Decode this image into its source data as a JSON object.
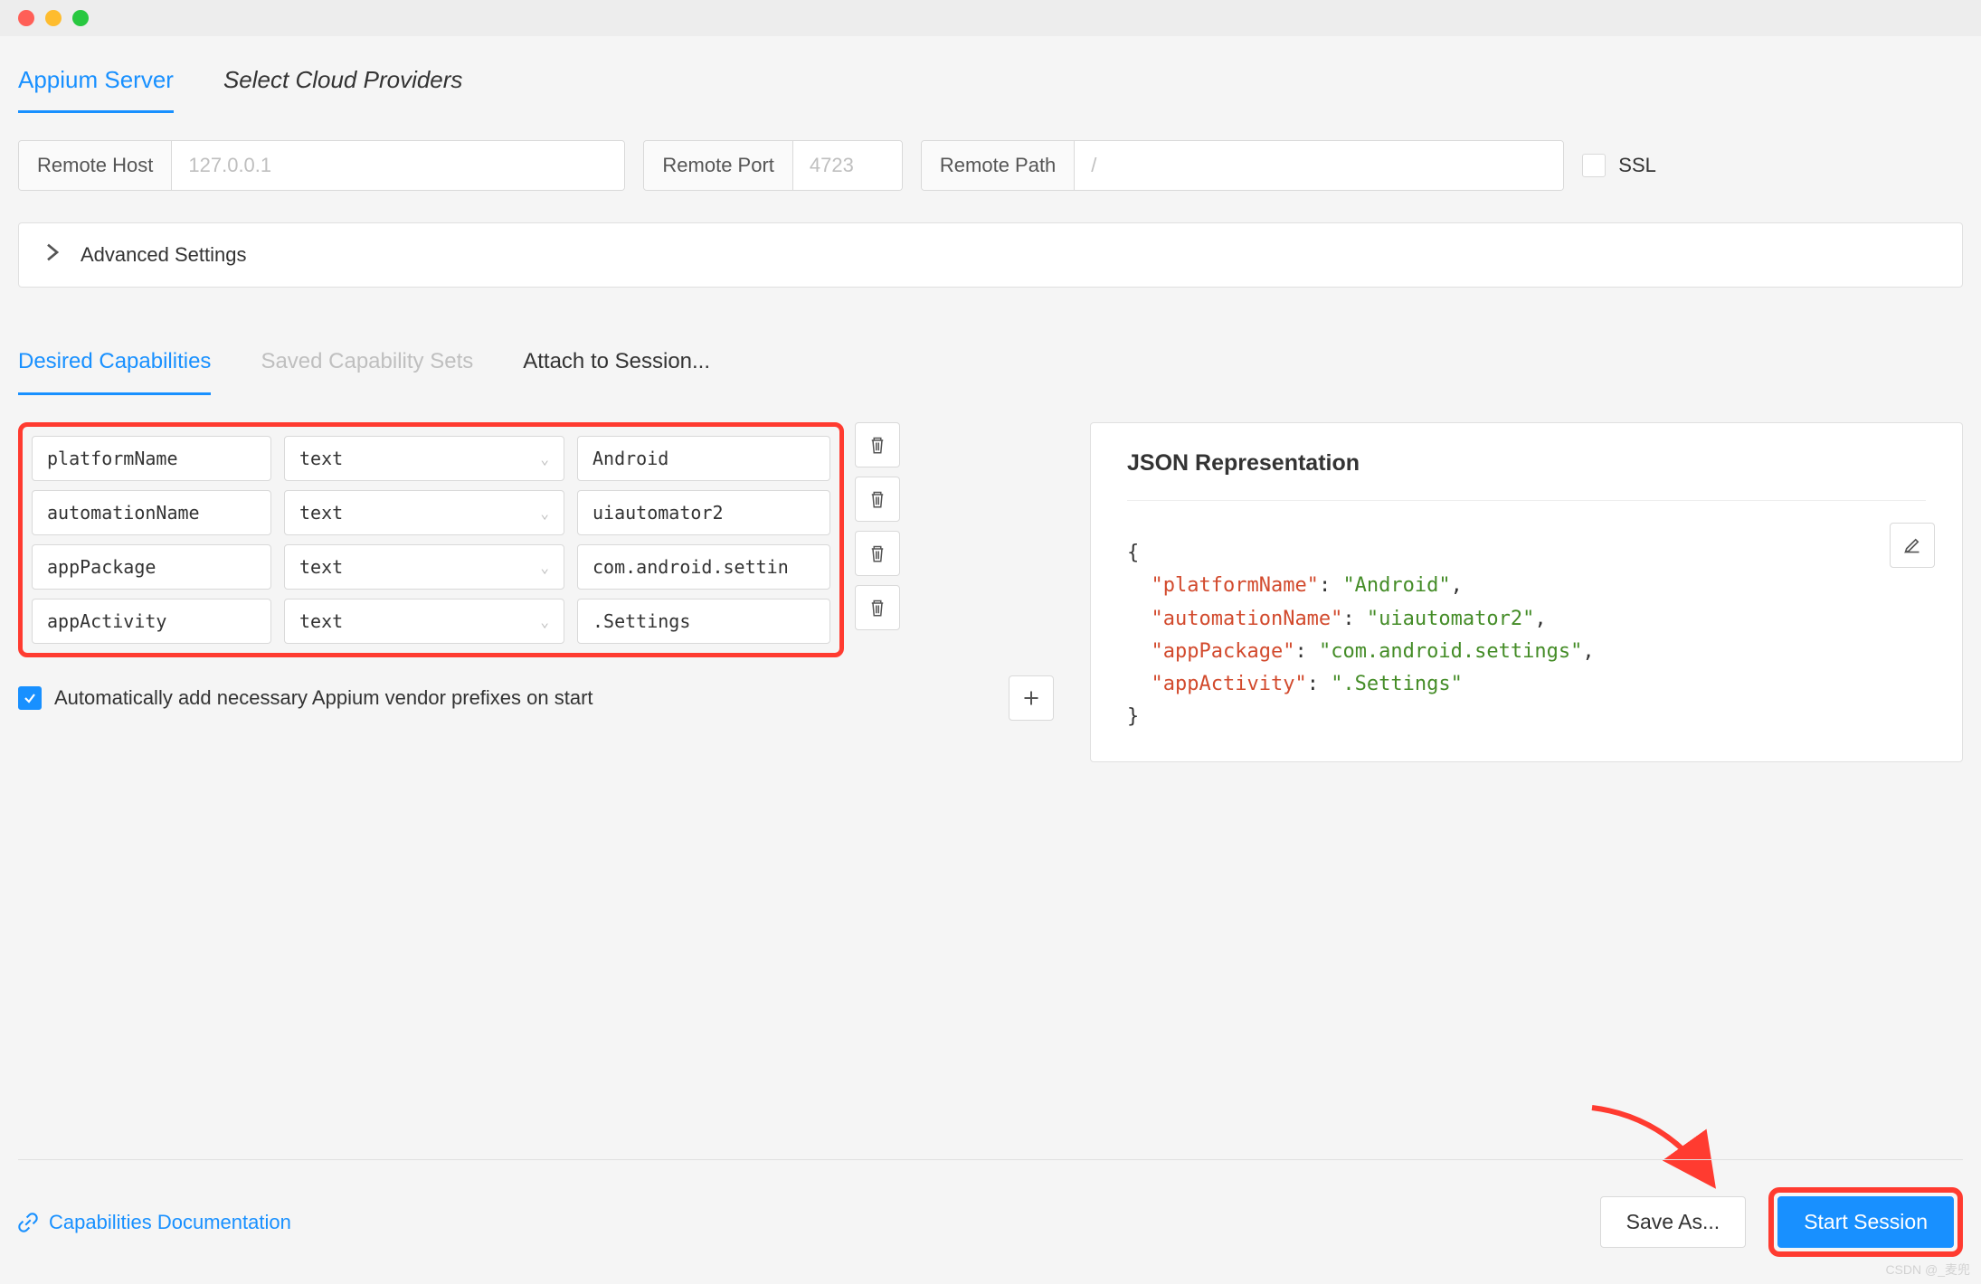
{
  "tabs": {
    "server": "Appium Server",
    "cloud": "Select Cloud Providers"
  },
  "conn": {
    "remoteHostLabel": "Remote Host",
    "remoteHostPlaceholder": "127.0.0.1",
    "remotePortLabel": "Remote Port",
    "remotePortPlaceholder": "4723",
    "remotePathLabel": "Remote Path",
    "remotePathPlaceholder": "/",
    "sslLabel": "SSL"
  },
  "advanced": {
    "label": "Advanced Settings"
  },
  "capTabs": {
    "desired": "Desired Capabilities",
    "saved": "Saved Capability Sets",
    "attach": "Attach to Session..."
  },
  "caps": [
    {
      "name": "platformName",
      "type": "text",
      "value": "Android"
    },
    {
      "name": "automationName",
      "type": "text",
      "value": "uiautomator2"
    },
    {
      "name": "appPackage",
      "type": "text",
      "value": "com.android.settin"
    },
    {
      "name": "appActivity",
      "type": "text",
      "value": ".Settings"
    }
  ],
  "autoPrefix": {
    "label": "Automatically add necessary Appium vendor prefixes on start",
    "checked": true
  },
  "json": {
    "title": "JSON Representation",
    "pairs": [
      {
        "k": "platformName",
        "v": "Android"
      },
      {
        "k": "automationName",
        "v": "uiautomator2"
      },
      {
        "k": "appPackage",
        "v": "com.android.settings"
      },
      {
        "k": "appActivity",
        "v": ".Settings"
      }
    ]
  },
  "footer": {
    "docLink": "Capabilities Documentation",
    "saveAs": "Save As...",
    "start": "Start Session"
  },
  "watermark": "CSDN @_麦兜"
}
